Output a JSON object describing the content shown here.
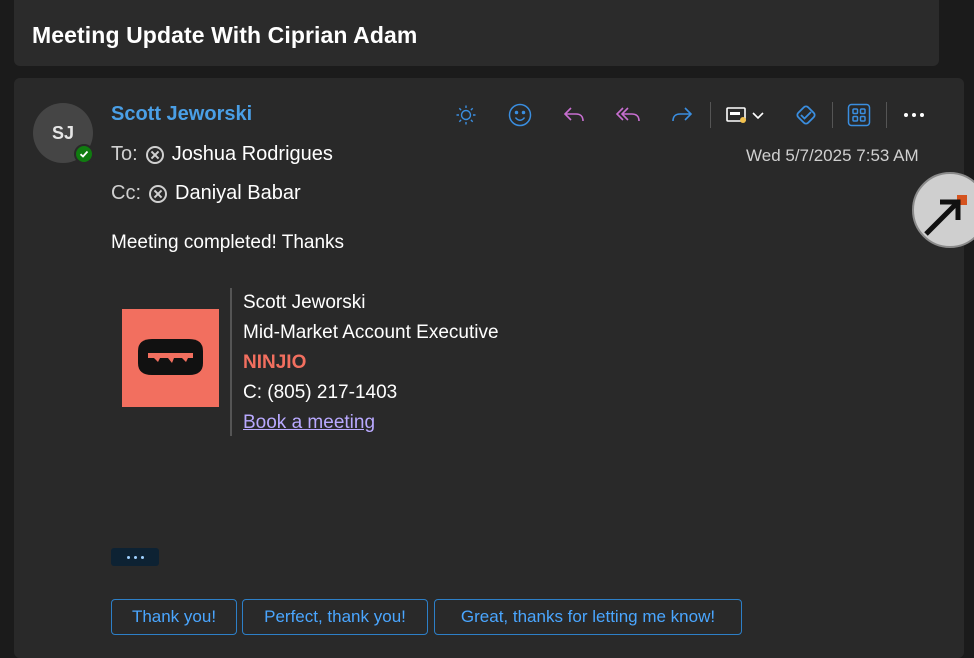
{
  "subject": "Meeting Update With Ciprian Adam",
  "sender": {
    "initials": "SJ",
    "name": "Scott Jeworski"
  },
  "recipients": {
    "to_label": "To:",
    "to_name": "Joshua Rodrigues",
    "cc_label": "Cc:",
    "cc_name": "Daniyal Babar"
  },
  "timestamp": "Wed 5/7/2025 7:53 AM",
  "body": "Meeting completed! Thanks",
  "signature": {
    "name": "Scott Jeworski",
    "title": "Mid-Market Account Executive",
    "company": "NINJIO",
    "phone": "C: (805) 217-1403",
    "link": "Book a meeting"
  },
  "quick_replies": [
    "Thank you!",
    "Perfect, thank you!",
    "Great, thanks for letting me know!"
  ],
  "toolbar_icons": [
    "brightness-icon",
    "emoji-icon",
    "reply-icon",
    "reply-all-icon",
    "forward-icon",
    "immersive-reader-icon",
    "chevron-down-icon",
    "loop-icon",
    "apps-icon",
    "more-icon"
  ],
  "colors": {
    "accent": "#4a9fe6",
    "brand": "#f26f5f",
    "presence": "#107c10",
    "link": "#b9a9ff"
  }
}
